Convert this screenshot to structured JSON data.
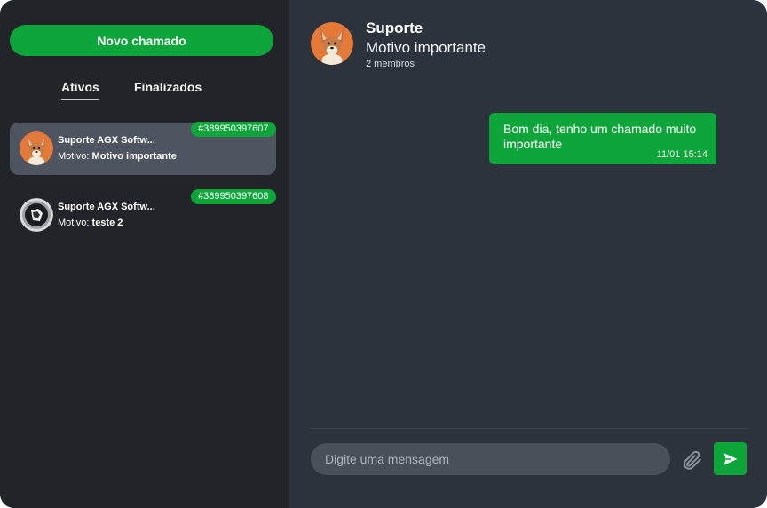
{
  "sidebar": {
    "new_button_label": "Novo chamado",
    "tabs": [
      {
        "label": "Ativos",
        "active": true
      },
      {
        "label": "Finalizados",
        "active": false
      }
    ],
    "tickets": [
      {
        "name": "Suporte AGX Softw...",
        "motive_label": "Motivo:",
        "motive": "Motivo importante",
        "id": "#389950397607",
        "avatar": "dog-avatar",
        "selected": true
      },
      {
        "name": "Suporte AGX Softw...",
        "motive_label": "Motivo:",
        "motive": "teste 2",
        "id": "#389950397608",
        "avatar": "shield-logo-avatar",
        "selected": false
      }
    ]
  },
  "chat": {
    "title": "Suporte",
    "subtitle": "Motivo importante",
    "members": "2 membros",
    "messages": [
      {
        "text": "Bom dia, tenho um chamado muito importante",
        "time": "11/01 15:14",
        "outgoing": true
      }
    ],
    "input_placeholder": "Digite uma mensagem",
    "attach_icon": "paperclip-icon",
    "send_icon": "send-icon"
  },
  "colors": {
    "accent": "#0ea63a",
    "sidebar_bg": "#212529",
    "chat_bg": "#2d333d",
    "selected_ticket_bg": "#4e5561",
    "input_bg": "#4a505a"
  }
}
